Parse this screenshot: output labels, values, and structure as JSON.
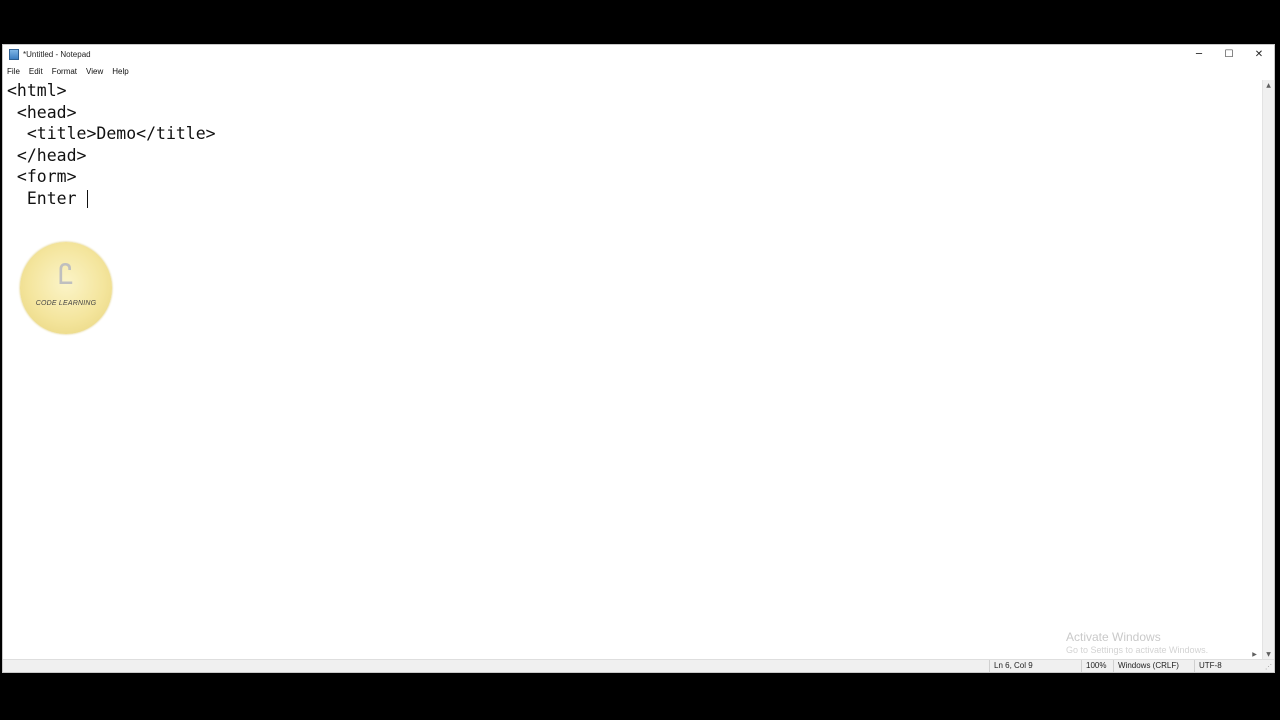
{
  "window": {
    "title": "*Untitled - Notepad",
    "icon": "notepad-icon",
    "controls": {
      "minimize": "─",
      "maximize": "☐",
      "close": "✕"
    }
  },
  "menubar": {
    "items": [
      {
        "label": "File"
      },
      {
        "label": "Edit"
      },
      {
        "label": "Format"
      },
      {
        "label": "View"
      },
      {
        "label": "Help"
      }
    ]
  },
  "editor": {
    "lines": [
      "<html>",
      " <head>",
      "  <title>Demo</title>",
      " </head>",
      " <form>",
      "  Enter "
    ]
  },
  "logo": {
    "mark": "Ꮭ",
    "text": "CODE LEARNING"
  },
  "watermark": {
    "title": "Activate Windows",
    "subtitle": "Go to Settings to activate Windows."
  },
  "statusbar": {
    "position": "Ln 6, Col 9",
    "zoom": "100%",
    "line_ending": "Windows (CRLF)",
    "encoding": "UTF-8"
  },
  "colors": {
    "background": "#000000",
    "window": "#ffffff",
    "statusbar": "#f0f0f0"
  }
}
